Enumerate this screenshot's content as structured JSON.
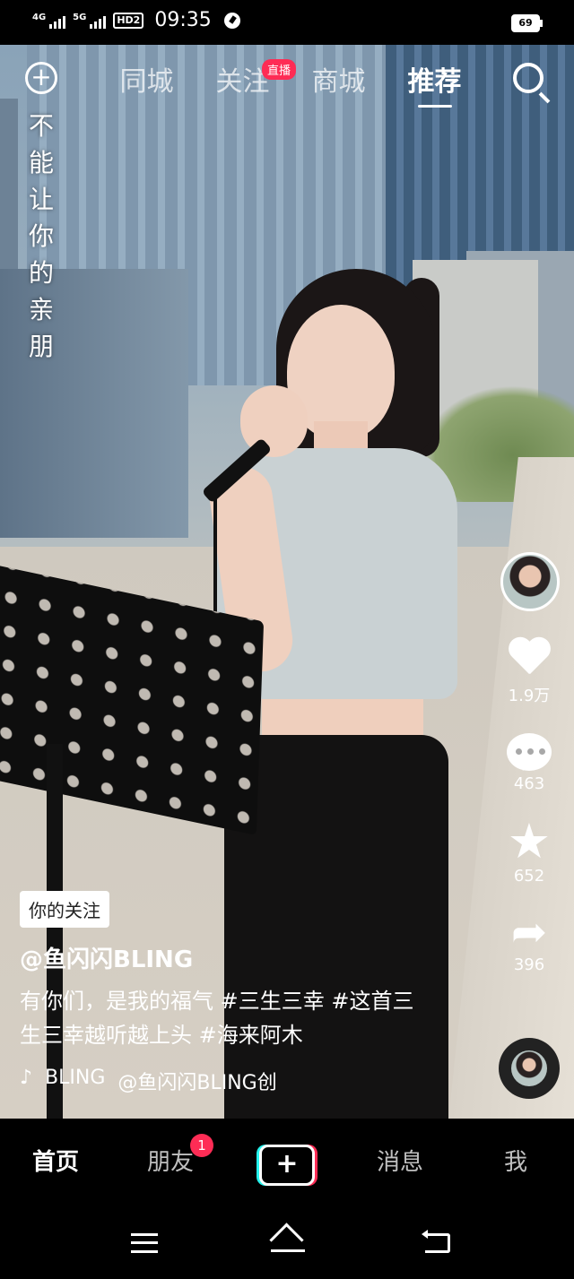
{
  "status_bar": {
    "net1": "4G",
    "net2": "5G",
    "hd": "HD2",
    "time": "09:35",
    "battery": "69"
  },
  "top_tabs": {
    "items": [
      "同城",
      "关注",
      "商城",
      "推荐"
    ],
    "active": "推荐",
    "live_badge": "直播"
  },
  "lyric": "不能让你的亲朋",
  "actions": {
    "likes": "1.9万",
    "comments": "463",
    "favorites": "652",
    "shares": "396"
  },
  "caption": {
    "follow_tag": "你的关注",
    "author": "@鱼闪闪BLING",
    "description": "有你们，是我的福气 #三生三幸 #这首三生三幸越听越上头 #海来阿木",
    "music_note": "♪",
    "music_title": "BLING",
    "music_author": "@鱼闪闪BLING创"
  },
  "bottom_nav": {
    "items": [
      "首页",
      "朋友",
      "消息",
      "我"
    ],
    "friends_badge": "1",
    "plus": "+"
  },
  "colors": {
    "accent": "#fe2c55",
    "cyan": "#25f4ee",
    "background": "#000000"
  },
  "icons": [
    "add-circle-icon",
    "search-icon",
    "heart-icon",
    "comment-icon",
    "star-icon",
    "share-icon",
    "music-disc-icon",
    "menu-icon",
    "home-icon",
    "back-icon"
  ]
}
